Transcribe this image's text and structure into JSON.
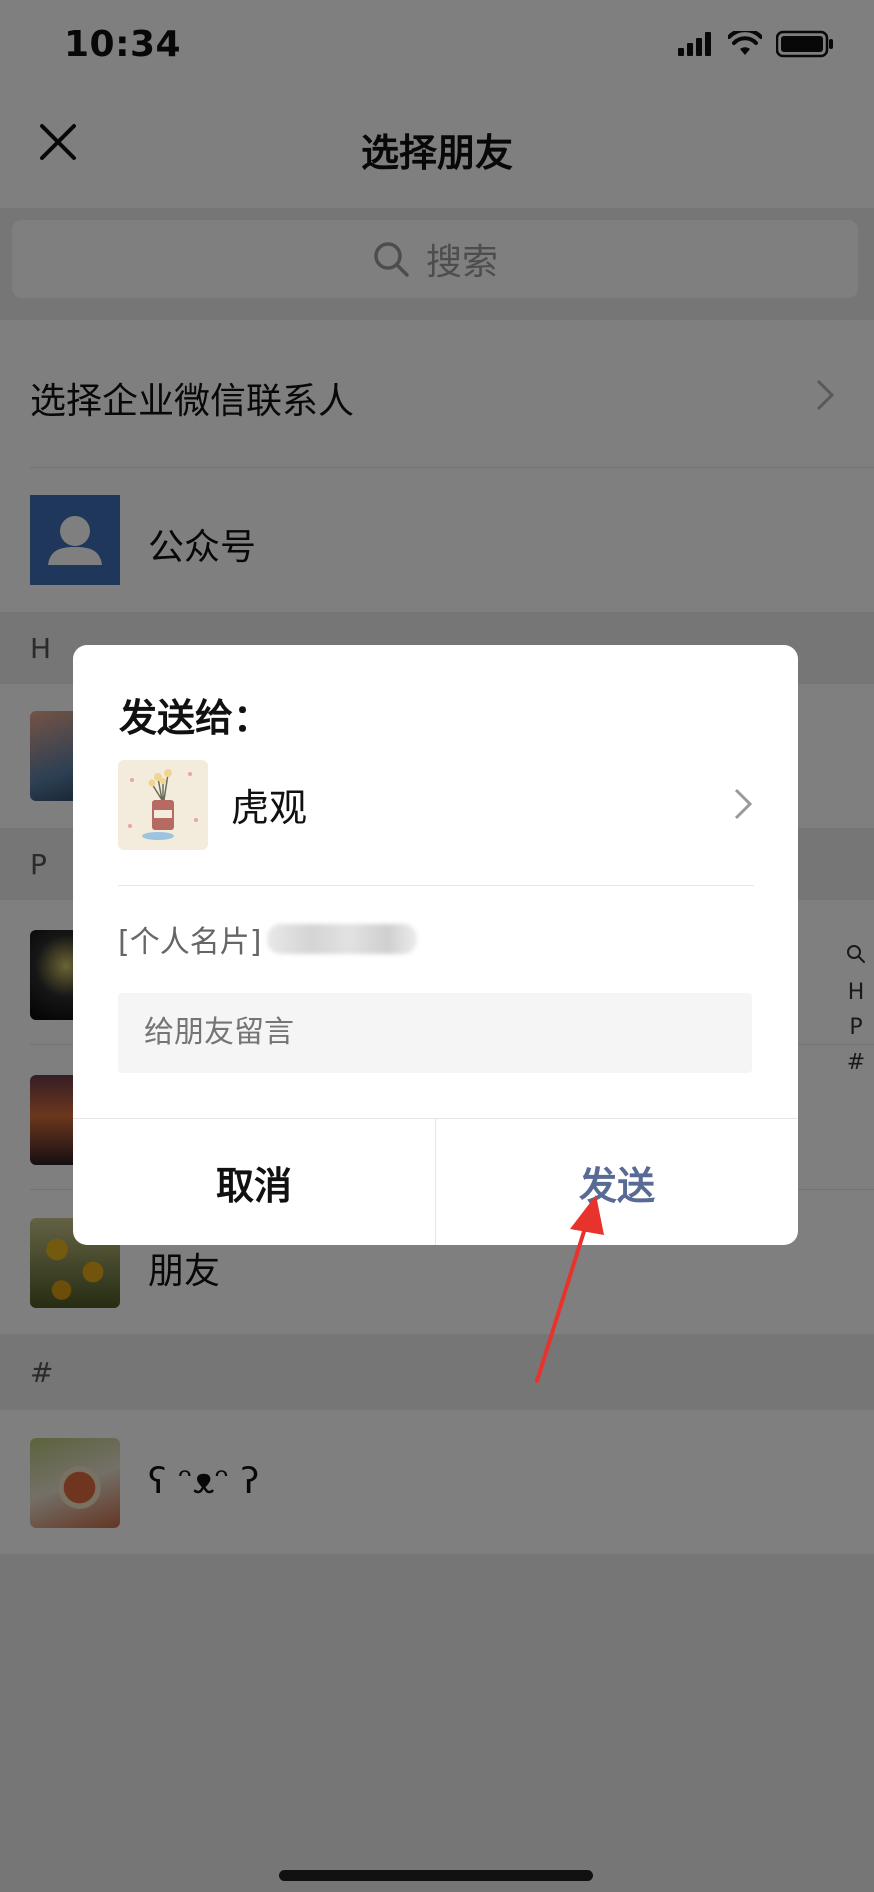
{
  "status": {
    "time": "10:34"
  },
  "nav": {
    "title": "选择朋友"
  },
  "search": {
    "placeholder": "搜索"
  },
  "list": {
    "enterprise_label": "选择企业微信联系人",
    "official_accounts_label": "公众号",
    "sections": [
      {
        "letter": "H"
      },
      {
        "letter": "P"
      },
      {
        "letter": "#"
      }
    ],
    "contacts": {
      "pengyou": "朋友",
      "emoticon": "ʕ ᵔᴥᵔ ʔ"
    }
  },
  "index_bar": [
    "Q",
    "H",
    "P",
    "#"
  ],
  "dialog": {
    "title": "发送给：",
    "recipient_name": "虎观",
    "card_label": "[个人名片]",
    "message_placeholder": "给朋友留言",
    "cancel_label": "取消",
    "send_label": "发送"
  },
  "colors": {
    "send_accent": "#576b95",
    "overlay": "rgba(0,0,0,0.5)",
    "annotation_arrow": "#e8322c",
    "official_account_bg": "#3f6fb5"
  },
  "icons": {
    "close": "close-icon",
    "search": "search-icon",
    "chevron": "chevron-right-icon",
    "official_account": "person-icon"
  }
}
